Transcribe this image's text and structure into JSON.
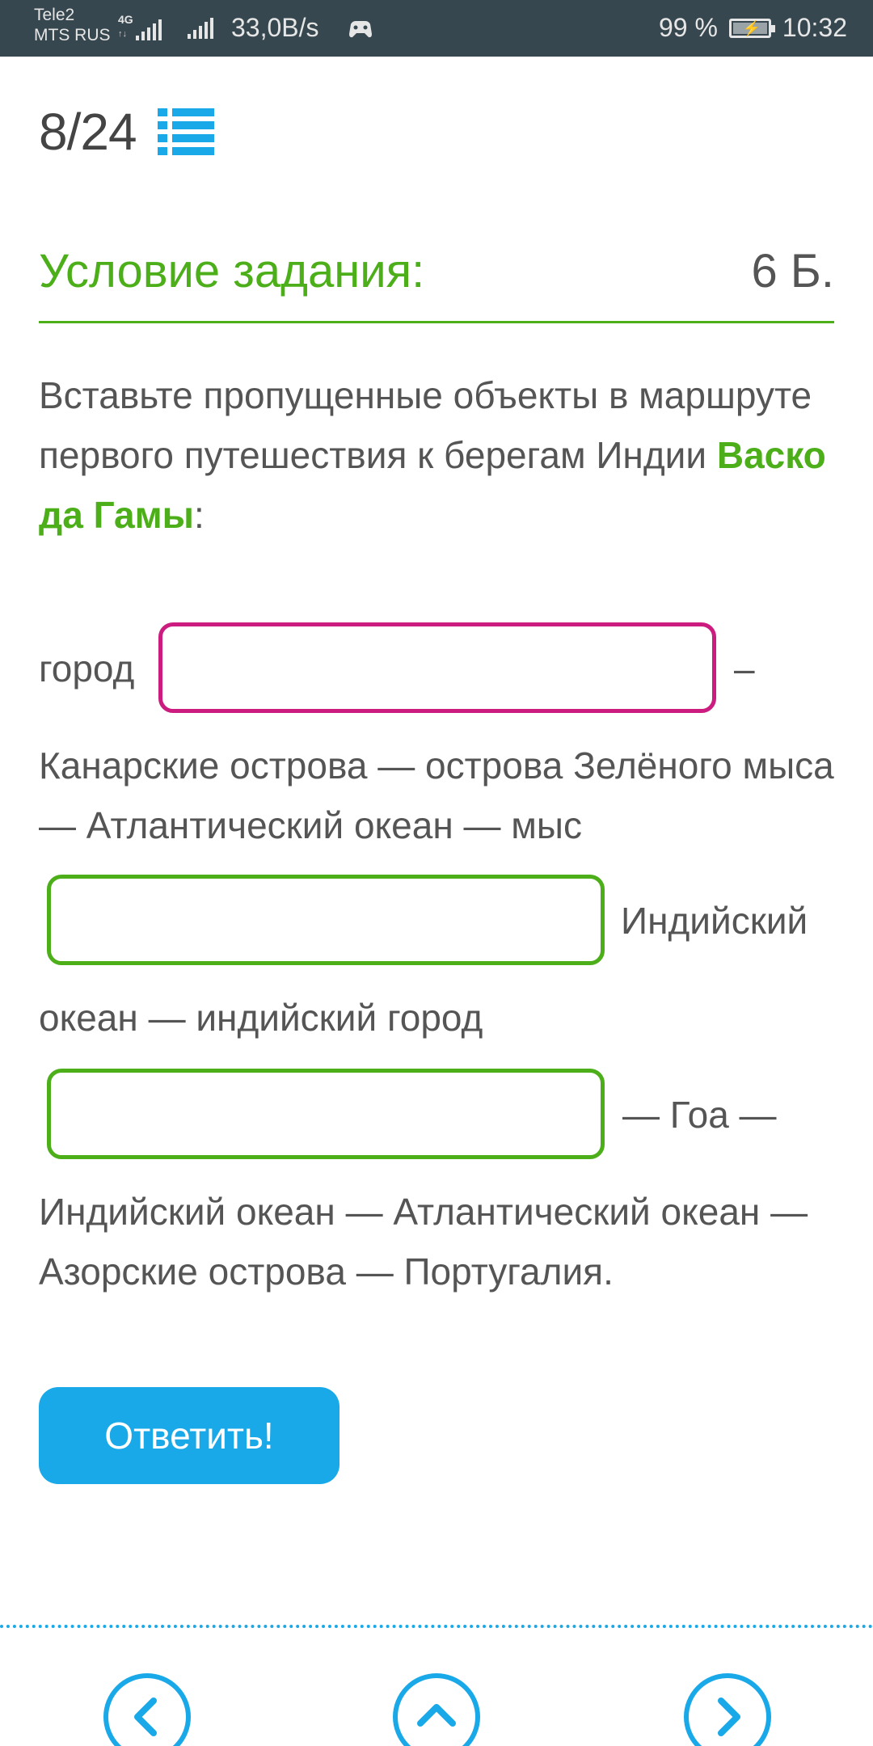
{
  "status_bar": {
    "carrier_1": "Tele2",
    "carrier_2": "MTS RUS",
    "network_type": "4G",
    "speed": "33,0B/s",
    "battery": "99 %",
    "time": "10:32",
    "icons": [
      "signal-icon",
      "game-controller-icon",
      "battery-charging-icon"
    ]
  },
  "header": {
    "progress": "8/24",
    "list_icon": "list-icon"
  },
  "condition": {
    "title": "Условие задания:",
    "points": "6 Б."
  },
  "task": {
    "intro": "Вставьте пропущенные объекты в маршруте первого путешествия к берегам Индии ",
    "highlight": "Васко да Гамы",
    "intro_end": ":",
    "word_city": "город",
    "dash_1": "–",
    "line_2": "Канарские острова — острова Зелёного мыса — Атлантический океан — мыс",
    "after_field_2": "Индийский",
    "line_3": "океан — индийский город",
    "after_field_3": "— Гоа —",
    "line_4": "Индийский океан — Атлантический океан — Азорские острова — Португалия."
  },
  "fields": [
    {
      "value": "",
      "placeholder": ""
    },
    {
      "value": "",
      "placeholder": ""
    },
    {
      "value": "",
      "placeholder": ""
    }
  ],
  "answer_button": "Ответить!",
  "colors": {
    "accent_green": "#4caf1a",
    "accent_blue": "#1aa9e8",
    "accent_pink": "#cc1c7f",
    "status_bar": "#37474f"
  },
  "nav": {
    "icons": [
      "chevron-left-icon",
      "chevron-up-icon",
      "chevron-right-icon"
    ]
  }
}
